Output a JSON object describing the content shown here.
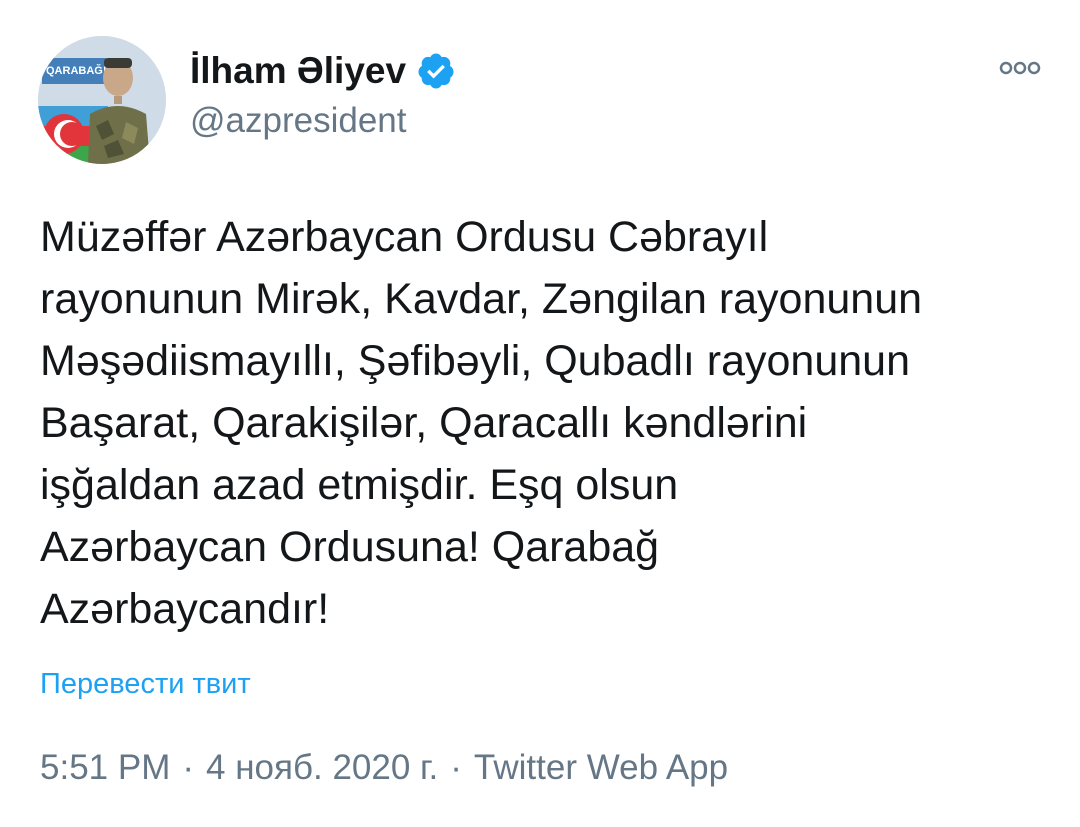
{
  "author": {
    "name": "İlham Əliyev",
    "handle": "@azpresident",
    "verified": true,
    "avatar_badge_text": "QARABAĞ!"
  },
  "tweet": {
    "text": "Müzəffər Azərbaycan Ordusu Cəbrayıl\nrayonunun Mirək, Kavdar, Zəngilan rayonunun\nMəşədiismayıllı, Şəfibəyli, Qubadlı rayonunun\nBaşarat, Qarakişilər, Qaracallı kəndlərini\nişğaldan azad etmişdir. Eşq olsun\nAzərbaycan Ordusuna! Qarabağ\nAzərbaycandır!",
    "translate_label": "Перевести твит",
    "time": "5:51 PM",
    "date": "4 нояб. 2020 г.",
    "separator": "·",
    "source": "Twitter Web App"
  },
  "icons": {
    "verified": "verified-badge-icon",
    "more": "more-options-icon"
  },
  "colors": {
    "text_primary": "#14171a",
    "text_secondary": "#657786",
    "accent": "#1da1f2"
  }
}
